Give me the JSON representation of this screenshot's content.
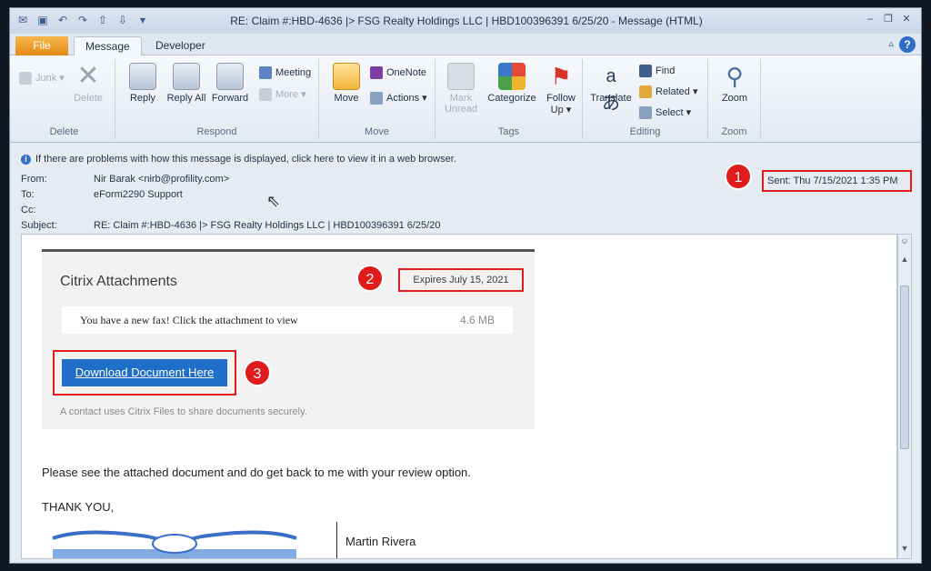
{
  "window": {
    "title": "RE: Claim #:HBD-4636 |> FSG Realty Holdings LLC | HBD100396391 6/25/20  -  Message (HTML)",
    "controls": [
      "–",
      "❐",
      "✕"
    ]
  },
  "tabs": [
    {
      "label": "File"
    },
    {
      "label": "Message"
    },
    {
      "label": "Developer"
    }
  ],
  "ribbon": {
    "groups": {
      "delete": {
        "label": "Delete",
        "junk": "Junk ▾",
        "delete": "Delete"
      },
      "respond": {
        "label": "Respond",
        "reply": "Reply",
        "reply_all": "Reply All",
        "forward": "Forward",
        "meeting": "Meeting",
        "more": "More ▾"
      },
      "move": {
        "label": "Move",
        "move": "Move",
        "onenote": "OneNote",
        "actions": "Actions ▾"
      },
      "tags": {
        "label": "Tags",
        "mark_unread": "Mark Unread",
        "categorize": "Categorize",
        "follow_up": "Follow Up ▾"
      },
      "editing": {
        "label": "Editing",
        "translate": "Translate",
        "find": "Find",
        "related": "Related ▾",
        "select": "Select ▾"
      },
      "zoom": {
        "label": "Zoom",
        "zoom": "Zoom"
      }
    }
  },
  "header": {
    "info": "If there are problems with how this message is displayed, click here to view it in a web browser.",
    "from_label": "From:",
    "from_value": "Nir Barak <nirb@profility.com>",
    "to_label": "To:",
    "to_value": "eForm2290 Support",
    "cc_label": "Cc:",
    "cc_value": "",
    "subject_label": "Subject:",
    "subject_value": "RE: Claim #:HBD-4636 |> FSG Realty Holdings LLC | HBD100396391 6/25/20",
    "sent": "Sent:   Thu 7/15/2021 1:35 PM"
  },
  "badges": [
    "1",
    "2",
    "3"
  ],
  "citrix": {
    "title": "Citrix Attachments",
    "expires": "Expires July 15, 2021",
    "fax_text": "You have a new fax! Click the attachment to view",
    "fax_size": "4.6 MB",
    "download": "Download Document Here",
    "footer": "A contact uses Citrix Files to share documents securely."
  },
  "message": {
    "line1": "Please see the attached document and do get back to me with your review option.",
    "line2": "THANK YOU,",
    "signature_name": "Martin Rivera"
  },
  "colors": {
    "annotation_red": "#e01b1b",
    "download_blue": "#1f6ec8",
    "file_tab_orange": "#e58a16"
  }
}
